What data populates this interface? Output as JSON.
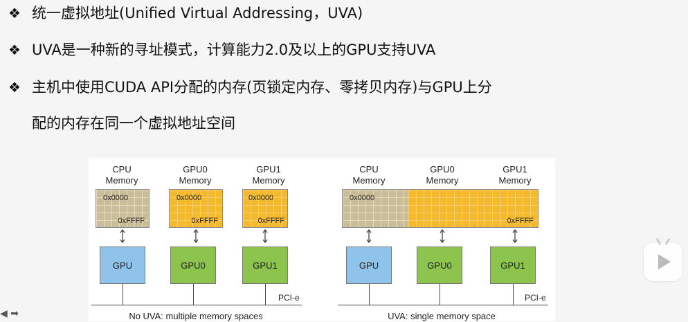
{
  "bullets": {
    "mark": "❖",
    "b1": "统一虚拟地址(Unified Virtual Addressing，UVA)",
    "b2": "UVA是一种新的寻址模式，计算能力2.0及以上的GPU支持UVA",
    "b3_line1": "主机中使用CUDA API分配的内存(页锁定内存、零拷贝内存)与GPU上分",
    "b3_line2": "配的内存在同一个虚拟地址空间"
  },
  "diagram": {
    "left": {
      "cpu_mem": "CPU\nMemory",
      "gpu0_mem": "GPU0\nMemory",
      "gpu1_mem": "GPU1\nMemory",
      "addr_start": "0x0000",
      "addr_end": "0xFFFF",
      "gpu": "GPU",
      "gpu0": "GPU0",
      "gpu1": "GPU1",
      "bus": "PCI-e",
      "caption": "No UVA: multiple memory spaces"
    },
    "right": {
      "cpu_mem": "CPU\nMemory",
      "gpu0_mem": "GPU0\nMemory",
      "gpu1_mem": "GPU1\nMemory",
      "addr_start": "0x0000",
      "addr_end": "0xFFFF",
      "gpu": "GPU",
      "gpu0": "GPU0",
      "gpu1": "GPU1",
      "bus": "PCI-e",
      "caption": "UVA: single memory space"
    },
    "colors": {
      "cpu_memory": "#c9bd9a",
      "gpu_memory": "#f5b92e",
      "cpu_box": "#8fc3ea",
      "gpu_box": "#8cc44e"
    }
  },
  "icons": {
    "player": "video-play-icon",
    "nav": "slide-nav-arrows-icon"
  },
  "nav": {
    "text": "◀ ➡"
  }
}
